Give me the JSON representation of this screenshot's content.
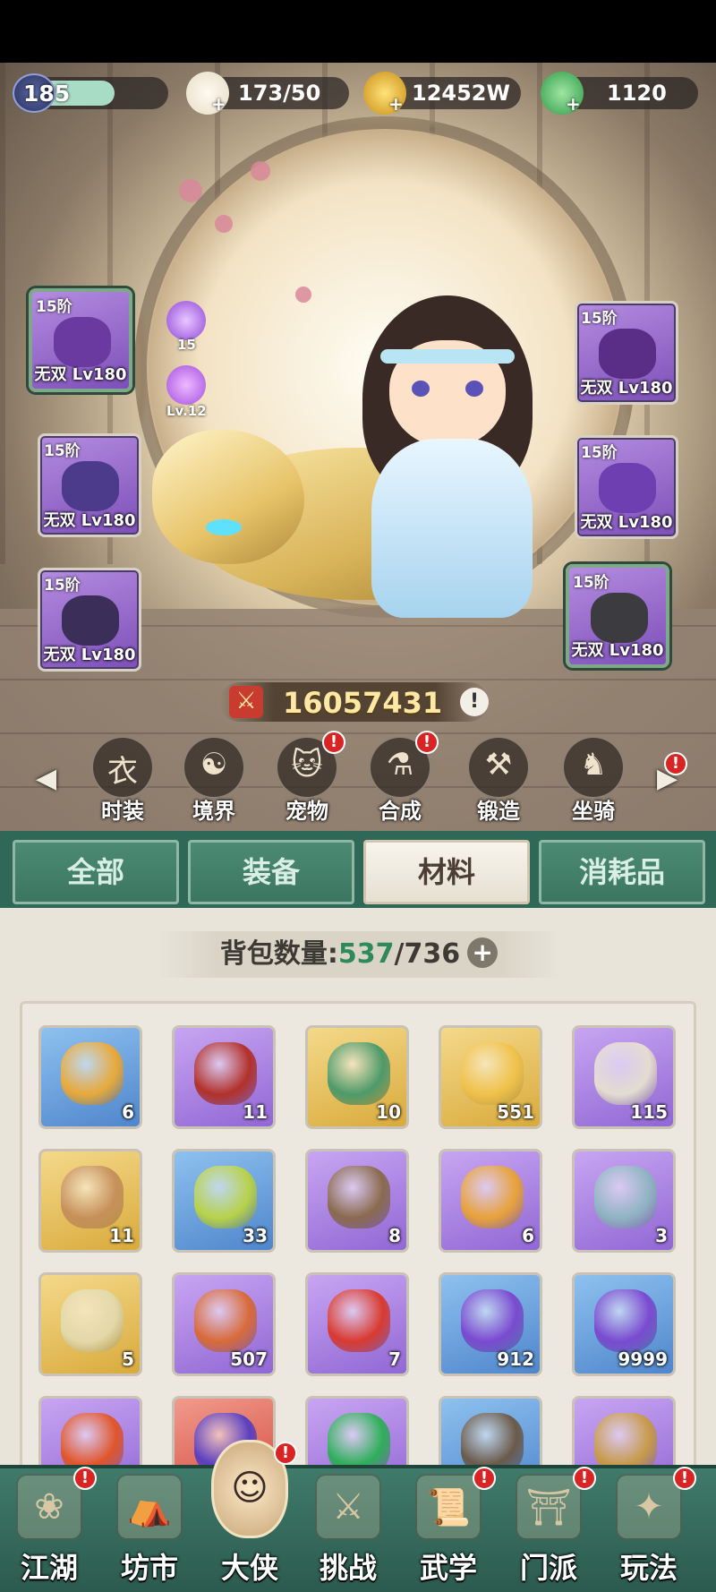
{
  "resources": {
    "level": "185",
    "stamina": "173/50",
    "coins": "12452W",
    "jade": "1120"
  },
  "equipment": {
    "left": [
      {
        "tier": "15阶",
        "level": "无双 Lv180"
      },
      {
        "tier": "15阶",
        "level": "无双 Lv180"
      },
      {
        "tier": "15阶",
        "level": "无双 Lv180"
      }
    ],
    "right": [
      {
        "tier": "15阶",
        "level": "无双 Lv180"
      },
      {
        "tier": "15阶",
        "level": "无双 Lv180"
      },
      {
        "tier": "15阶",
        "level": "无双 Lv180"
      }
    ],
    "gems": [
      {
        "label": "15"
      },
      {
        "label": "Lv.12"
      }
    ]
  },
  "power": "16057431",
  "functions": [
    {
      "label": "时装",
      "icon": "fashion-icon"
    },
    {
      "label": "境界",
      "icon": "realm-icon"
    },
    {
      "label": "宠物",
      "icon": "pet-icon"
    },
    {
      "label": "合成",
      "icon": "synthesis-icon"
    },
    {
      "label": "锻造",
      "icon": "forge-icon"
    },
    {
      "label": "坐骑",
      "icon": "mount-icon"
    }
  ],
  "tabs": [
    "全部",
    "装备",
    "材料",
    "消耗品"
  ],
  "active_tab": "材料",
  "bag": {
    "label": "背包数量:",
    "current": "537",
    "max": "/736"
  },
  "items": [
    {
      "qty": "6",
      "rarity": "blue",
      "icon": "flower-basket-icon",
      "color": "#e8a93a"
    },
    {
      "qty": "11",
      "rarity": "purple",
      "icon": "wine-jar-icon",
      "color": "#b2312a"
    },
    {
      "qty": "10",
      "rarity": "gold",
      "icon": "jade-ornament-icon",
      "color": "#4e9a6a"
    },
    {
      "qty": "551",
      "rarity": "gold",
      "icon": "golden-key-icon",
      "color": "#f0c24a"
    },
    {
      "qty": "115",
      "rarity": "purple",
      "icon": "scroll-icon",
      "color": "#e4ddd0"
    },
    {
      "qty": "11",
      "rarity": "gold",
      "icon": "books-icon",
      "color": "#c7905a"
    },
    {
      "qty": "33",
      "rarity": "blue",
      "icon": "fruit-icon",
      "color": "#b8d24a"
    },
    {
      "qty": "8",
      "rarity": "purple",
      "icon": "pouch-icon",
      "color": "#8a6a4e"
    },
    {
      "qty": "6",
      "rarity": "purple",
      "icon": "card-icon",
      "color": "#e8a23a"
    },
    {
      "qty": "3",
      "rarity": "purple",
      "icon": "sack-icon",
      "color": "#8fb4c2"
    },
    {
      "qty": "5",
      "rarity": "gold",
      "icon": "scroll-case-icon",
      "color": "#e2d8a8"
    },
    {
      "qty": "507",
      "rarity": "purple",
      "icon": "lingzhi-icon",
      "color": "#d86a3a"
    },
    {
      "qty": "7",
      "rarity": "purple",
      "icon": "firecracker-icon",
      "color": "#d93a30"
    },
    {
      "qty": "912",
      "rarity": "blue",
      "icon": "berry-icon",
      "color": "#7a4ad0"
    },
    {
      "qty": "9999",
      "rarity": "blue",
      "icon": "berry-icon",
      "color": "#7a4ad0"
    },
    {
      "qty": "",
      "rarity": "purple",
      "icon": "persimmon-icon",
      "color": "#e0552a"
    },
    {
      "qty": "",
      "rarity": "red",
      "icon": "gourd-icon",
      "color": "#5b3fc0"
    },
    {
      "qty": "",
      "rarity": "purple",
      "icon": "leaf-orb-icon",
      "color": "#2fae5a"
    },
    {
      "qty": "",
      "rarity": "blue",
      "icon": "claw-icon",
      "color": "#6b5a4a"
    },
    {
      "qty": "",
      "rarity": "purple",
      "icon": "claw-icon",
      "color": "#c79a4a"
    }
  ],
  "nav": [
    {
      "label": "江湖",
      "icon": "jianghu-icon",
      "badge": "!"
    },
    {
      "label": "坊市",
      "icon": "market-icon",
      "badge": ""
    },
    {
      "label": "大侠",
      "icon": "hero-portrait-icon",
      "badge": "!"
    },
    {
      "label": "挑战",
      "icon": "challenge-icon",
      "badge": ""
    },
    {
      "label": "武学",
      "icon": "martial-arts-icon",
      "badge": "!"
    },
    {
      "label": "门派",
      "icon": "sect-icon",
      "badge": "!"
    },
    {
      "label": "玩法",
      "icon": "gameplay-icon",
      "badge": "!"
    }
  ]
}
